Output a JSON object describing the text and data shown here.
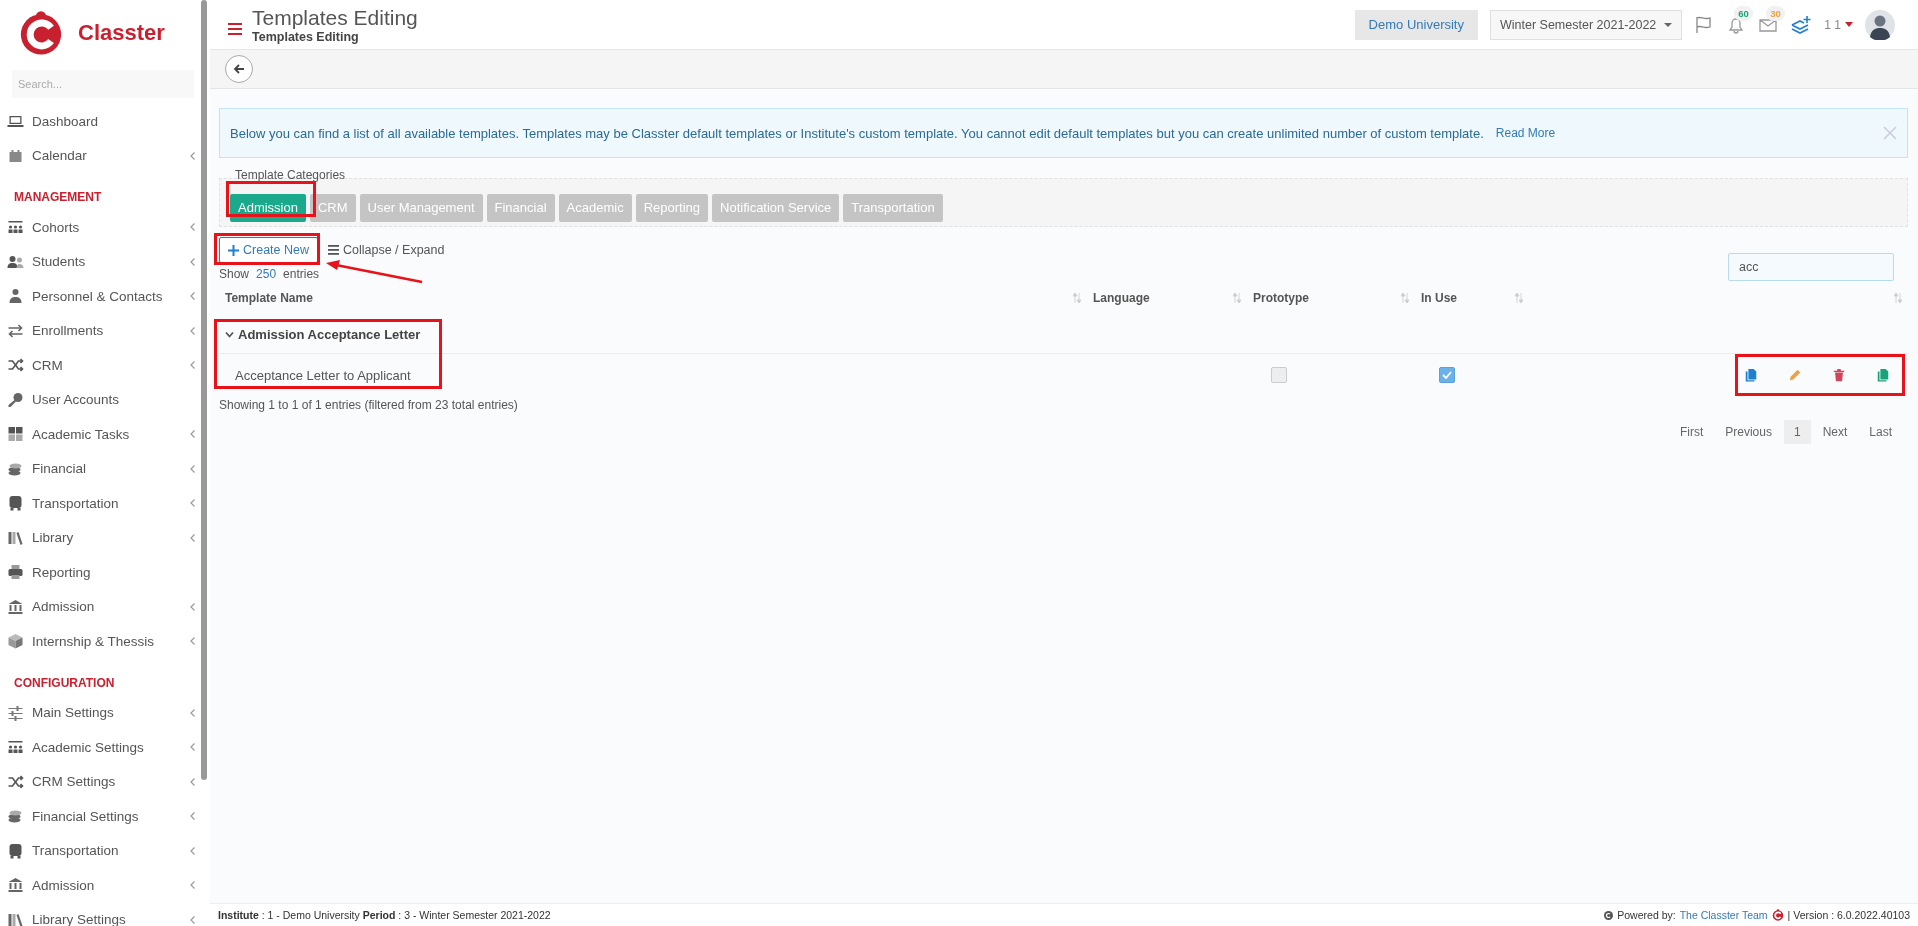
{
  "logo": {
    "name": "Classter"
  },
  "sidebar": {
    "search_placeholder": "Search...",
    "sections": [
      {
        "items": [
          {
            "label": "Dashboard",
            "has_submenu": false
          },
          {
            "label": "Calendar",
            "has_submenu": true
          }
        ]
      },
      {
        "title": "MANAGEMENT",
        "items": [
          {
            "label": "Cohorts",
            "has_submenu": true
          },
          {
            "label": "Students",
            "has_submenu": true
          },
          {
            "label": "Personnel & Contacts",
            "has_submenu": true
          },
          {
            "label": "Enrollments",
            "has_submenu": true
          },
          {
            "label": "CRM",
            "has_submenu": true
          },
          {
            "label": "User Accounts",
            "has_submenu": false
          },
          {
            "label": "Academic Tasks",
            "has_submenu": true
          },
          {
            "label": "Financial",
            "has_submenu": true
          },
          {
            "label": "Transportation",
            "has_submenu": true
          },
          {
            "label": "Library",
            "has_submenu": true
          },
          {
            "label": "Reporting",
            "has_submenu": false
          },
          {
            "label": "Admission",
            "has_submenu": true
          },
          {
            "label": "Internship & Thessis",
            "has_submenu": true
          }
        ]
      },
      {
        "title": "CONFIGURATION",
        "items": [
          {
            "label": "Main Settings",
            "has_submenu": true
          },
          {
            "label": "Academic Settings",
            "has_submenu": true
          },
          {
            "label": "CRM Settings",
            "has_submenu": true
          },
          {
            "label": "Financial Settings",
            "has_submenu": true
          },
          {
            "label": "Transportation",
            "has_submenu": true
          },
          {
            "label": "Admission",
            "has_submenu": true
          },
          {
            "label": "Library Settings",
            "has_submenu": true
          }
        ]
      }
    ]
  },
  "header": {
    "title": "Templates Editing",
    "subtitle": "Templates Editing",
    "institute": "Demo University",
    "semester": "Winter Semester 2021-2022",
    "notifications_badge": "60",
    "messages_badge": "30",
    "user": "1 1"
  },
  "alert": {
    "text": "Below you can find a list of all available templates. Templates may be Classter default templates or Institute's custom template. You cannot edit default templates but you can create unlimited number of custom template.",
    "link": "Read More"
  },
  "categories": {
    "legend": "Template Categories",
    "tabs": [
      {
        "label": "Admission",
        "selected": true
      },
      {
        "label": "CRM",
        "selected": false
      },
      {
        "label": "User Management",
        "selected": false
      },
      {
        "label": "Financial",
        "selected": false
      },
      {
        "label": "Academic",
        "selected": false
      },
      {
        "label": "Reporting",
        "selected": false
      },
      {
        "label": "Notification Service",
        "selected": false
      },
      {
        "label": "Transportation",
        "selected": false
      }
    ]
  },
  "toolbar": {
    "create": "Create New",
    "collapse": "Collapse / Expand"
  },
  "length": {
    "before": "Show",
    "value": "250",
    "after": "entries"
  },
  "search": {
    "value": "acc"
  },
  "table": {
    "columns": [
      "Template Name",
      "Language",
      "Prototype",
      "In Use"
    ],
    "groups": [
      {
        "name": "Admission Acceptance Letter",
        "expanded": true,
        "rows": [
          {
            "template_name": "Acceptance Letter to Applicant",
            "prototype": false,
            "in_use": true
          }
        ]
      }
    ]
  },
  "info": "Showing 1 to 1 of 1 entries (filtered from 23 total entries)",
  "pagination": [
    {
      "label": "First",
      "selected": false
    },
    {
      "label": "Previous",
      "selected": false
    },
    {
      "label": "1",
      "selected": true
    },
    {
      "label": "Next",
      "selected": false
    },
    {
      "label": "Last",
      "selected": false
    }
  ],
  "footer": {
    "left": "**Institute** : 1 - Demo University **Period** : 3 - Winter Semester 2021-2022",
    "powered": "Powered by:",
    "team": "The Classter Team",
    "version": "| Version : 6.0.2022.40103"
  }
}
